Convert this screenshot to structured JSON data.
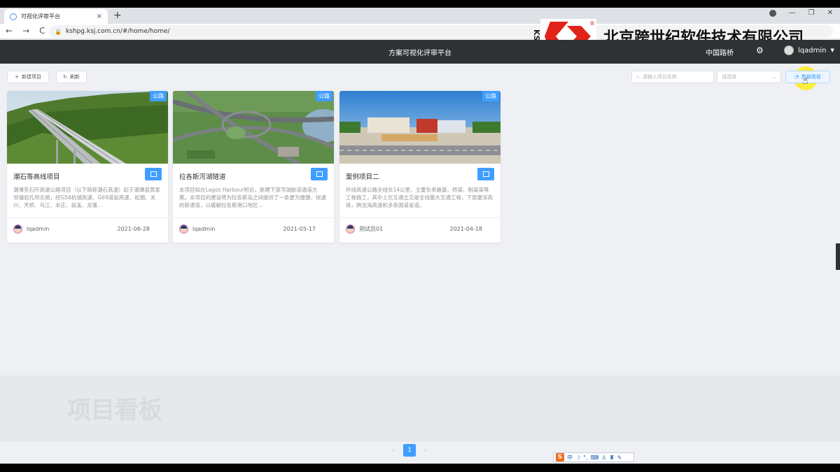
{
  "browser": {
    "tab_title": "可视化评审平台",
    "tab_close": "×",
    "new_tab": "+",
    "url": "kshpg.ksj.com.cn/#/home/home/",
    "nav_back": "←",
    "nav_forward": "→",
    "nav_reload": "C"
  },
  "watermark": {
    "letters": "KSJ",
    "registered": "®",
    "company": "北京跨世纪软件技术有限公司"
  },
  "header": {
    "title": "方案可视化评审平台",
    "map_link": "中国路桥",
    "username": "lqadmin",
    "caret": "▼"
  },
  "toolbar": {
    "new_project": "新建项目",
    "refresh": "刷新",
    "search_placeholder": "请输入项目名称",
    "select_placeholder": "请选择",
    "board_button": "数据看板"
  },
  "cards": [
    {
      "tag": "公路",
      "title": "潮石等高线项目",
      "desc": "潮潭至石阡高速公路项目（以下简称潮石高速）起于潮潭县黄家坝镇岩孔坝北侧，经G56杭瑞高速、G69道瓮高速、松烟、关兴、天桥、乌江、本庄、翁溪、龙塘…",
      "user": "lqadmin",
      "date": "2021-06-28"
    },
    {
      "tag": "公路",
      "title": "拉各斯泻湖隧道",
      "desc": "本项目拟在Lagos Harbour附近，新建下穿泻湖航道通道方案。本项目的建设将为拉各斯岛之间提供了一条更为便捷、快速的新通道，以缓解拉各斯港口地区…",
      "user": "lqadmin",
      "date": "2021-05-17"
    },
    {
      "tag": "公路",
      "title": "案例项目二",
      "desc": "环线高速公路全线长14公里，主要负责路基、桥梁、制梁梁等工程施工，其中上北互通立交是全线最大互通工程，下穿厦深高铁，跨沈海高速和多条国道省道。",
      "user": "测试员01",
      "date": "2021-04-18"
    }
  ],
  "ghost_text": "项目看板",
  "pagination": {
    "prev": "‹",
    "current": "1",
    "next": "›"
  },
  "ime": {
    "logo": "S",
    "lang": "中"
  },
  "colors": {
    "primary": "#409eff",
    "header_bg": "#2f3234",
    "page_bg": "#eef0f4"
  }
}
